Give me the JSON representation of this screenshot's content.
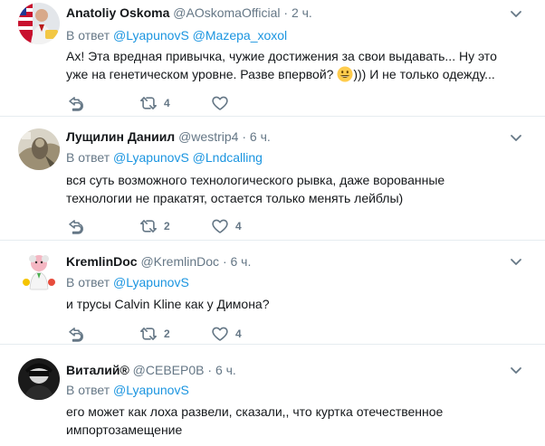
{
  "tweets": [
    {
      "name": "Anatoliy Oskoma",
      "handle": "@AOskomaOfficial",
      "dot": "·",
      "time": "2 ч.",
      "reply_prefix": "В ответ",
      "mentions": [
        "@LyapunovS",
        "@Mazepa_xoxol"
      ],
      "text_before_emoji": "Ах! Эта вредная привычка, чужие достижения за свои выдавать... Ну это уже на генетическом уровне. Разве впервой? ",
      "emoji": "grinning-face-emoji",
      "text_after_emoji": "))) И не только одежду...",
      "retweets": "4",
      "likes": ""
    },
    {
      "name": "Лущилин Даниил",
      "handle": "@westrip4",
      "dot": "·",
      "time": "6 ч.",
      "reply_prefix": "В ответ",
      "mentions": [
        "@LyapunovS",
        "@Lndcalling"
      ],
      "text": "вся суть возможного технологического рывка, даже ворованные технологии не пракатят, остается только менять лейблы)",
      "retweets": "2",
      "likes": "4"
    },
    {
      "name": "KremlinDoc",
      "handle": "@KremlinDoc",
      "dot": "·",
      "time": "6 ч.",
      "reply_prefix": "В ответ",
      "mentions": [
        "@LyapunovS"
      ],
      "text": "и трусы Calvin Kline как у Димона?",
      "retweets": "2",
      "likes": "4"
    },
    {
      "name": "Виталий®",
      "handle": "@СЕВЕР0В",
      "dot": "·",
      "time": "6 ч.",
      "reply_prefix": "В ответ",
      "mentions": [
        "@LyapunovS"
      ],
      "text": "его может как лоха развели, сказали,, что  куртка отечественное импортозамещение"
    }
  ],
  "colors": {
    "text": "#14171a",
    "secondary": "#657786",
    "link": "#1b95e0",
    "border": "#e6ecf0"
  },
  "icons": {
    "reply": "reply-icon",
    "retweet": "retweet-icon",
    "like": "heart-icon",
    "menu": "chevron-down-icon"
  }
}
